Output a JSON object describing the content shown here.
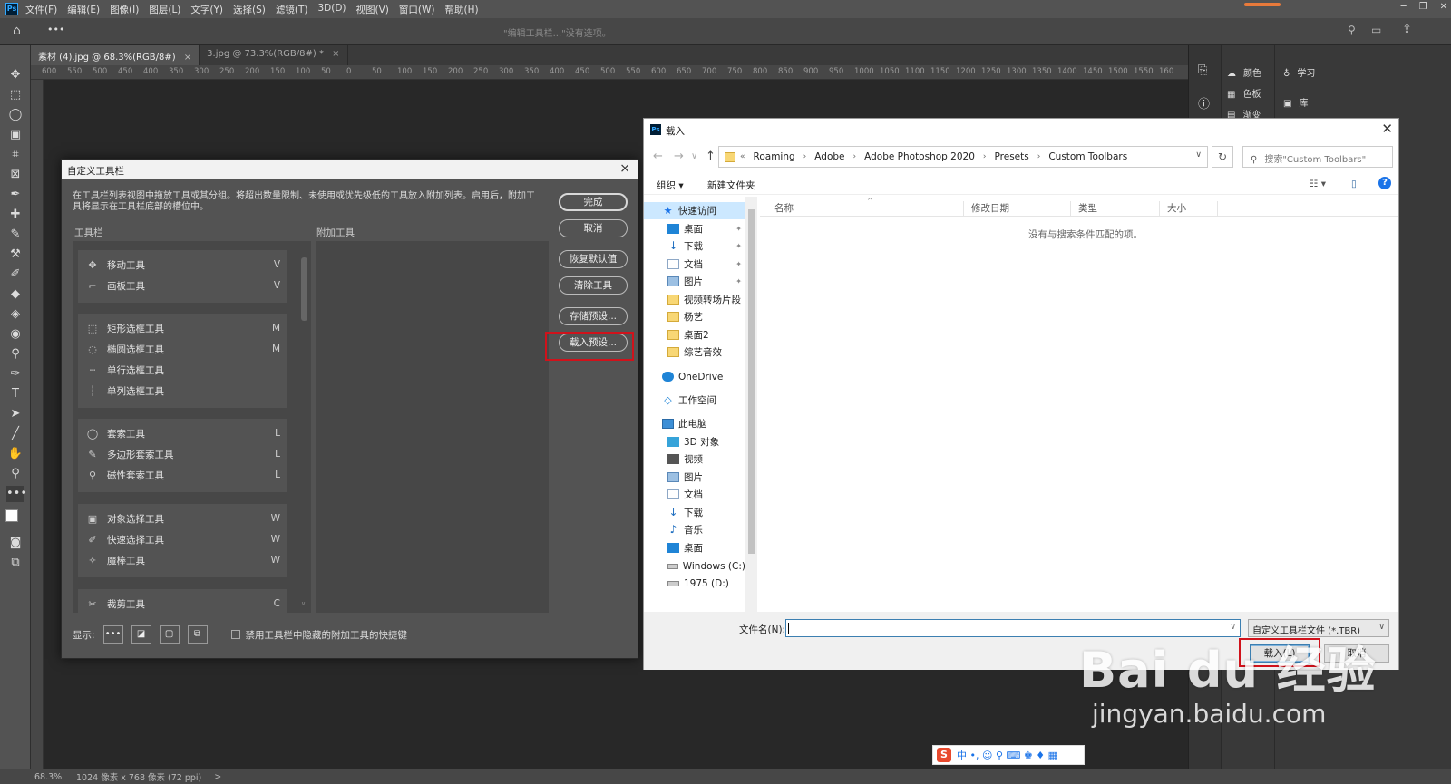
{
  "menubar": {
    "logo": "Ps",
    "items": [
      "文件(F)",
      "编辑(E)",
      "图像(I)",
      "图层(L)",
      "文字(Y)",
      "选择(S)",
      "滤镜(T)",
      "3D(D)",
      "视图(V)",
      "窗口(W)",
      "帮助(H)"
    ]
  },
  "optbar": {
    "hint": "\"编辑工具栏...\"没有选项。",
    "more": "•••"
  },
  "tabs": [
    {
      "label": "素材 (4).jpg @ 68.3%(RGB/8#)",
      "close": "×"
    },
    {
      "label": "3.jpg @ 73.3%(RGB/8#) *",
      "close": "×"
    }
  ],
  "ruler": [
    "600",
    "550",
    "500",
    "450",
    "400",
    "350",
    "300",
    "250",
    "200",
    "150",
    "100",
    "50",
    "0",
    "50",
    "100",
    "150",
    "200",
    "250",
    "300",
    "350",
    "400",
    "450",
    "500",
    "550",
    "600",
    "650",
    "700",
    "750",
    "800",
    "850",
    "900",
    "950",
    "1000",
    "1050",
    "1100",
    "1150",
    "1200",
    "1250",
    "1300",
    "1350",
    "1400",
    "1450",
    "1500",
    "1550",
    "160"
  ],
  "panels": {
    "color": "颜色",
    "swatches": "色板",
    "gradient": "渐变",
    "learn": "学习",
    "library": "库"
  },
  "status": {
    "zoom": "68.3%",
    "info": "1024 像素 x 768 像素 (72 ppi)",
    "arrow": ">"
  },
  "customize": {
    "title": "自定义工具栏",
    "description": "在工具栏列表视图中拖放工具或其分组。将超出数量限制、未使用或优先级低的工具放入附加列表。启用后，附加工具将显示在工具栏底部的槽位中。",
    "toolbar_label": "工具栏",
    "extra_label": "附加工具",
    "groups": [
      [
        {
          "icon": "✥",
          "label": "移动工具",
          "key": "V"
        },
        {
          "icon": "⌐",
          "label": "画板工具",
          "key": "V"
        }
      ],
      [
        {
          "icon": "⬚",
          "label": "矩形选框工具",
          "key": "M"
        },
        {
          "icon": "◌",
          "label": "椭圆选框工具",
          "key": "M"
        },
        {
          "icon": "┄",
          "label": "单行选框工具",
          "key": ""
        },
        {
          "icon": "┆",
          "label": "单列选框工具",
          "key": ""
        }
      ],
      [
        {
          "icon": "◯",
          "label": "套索工具",
          "key": "L"
        },
        {
          "icon": "✎",
          "label": "多边形套索工具",
          "key": "L"
        },
        {
          "icon": "⚲",
          "label": "磁性套索工具",
          "key": "L"
        }
      ],
      [
        {
          "icon": "▣",
          "label": "对象选择工具",
          "key": "W"
        },
        {
          "icon": "✐",
          "label": "快速选择工具",
          "key": "W"
        },
        {
          "icon": "✧",
          "label": "魔棒工具",
          "key": "W"
        }
      ],
      [
        {
          "icon": "✂",
          "label": "裁剪工具",
          "key": "C"
        }
      ]
    ],
    "buttons": {
      "done": "完成",
      "cancel": "取消",
      "restore": "恢复默认值",
      "clear": "清除工具",
      "save": "存储预设...",
      "load": "载入预设..."
    },
    "show_label": "显示:",
    "show_icons": [
      "•••",
      "◪",
      "▢",
      "⧉"
    ],
    "checkbox_label": "禁用工具栏中隐藏的附加工具的快捷键"
  },
  "load_dialog": {
    "title": "载入",
    "logo": "Ps",
    "path": [
      "Roaming",
      "Adobe",
      "Adobe Photoshop 2020",
      "Presets",
      "Custom Toolbars"
    ],
    "path_prefix": "«",
    "search_placeholder": "搜索\"Custom Toolbars\"",
    "organize": "组织 ▾",
    "new_folder": "新建文件夹",
    "nav": [
      {
        "label": "快速访问",
        "type": "star",
        "sel": true
      },
      {
        "label": "桌面",
        "type": "blue",
        "pin": true
      },
      {
        "label": "下载",
        "type": "down",
        "pin": true
      },
      {
        "label": "文档",
        "type": "doc",
        "pin": true
      },
      {
        "label": "图片",
        "type": "pic",
        "pin": true
      },
      {
        "label": "视频转场片段",
        "type": "folder"
      },
      {
        "label": "杨艺",
        "type": "folder"
      },
      {
        "label": "桌面2",
        "type": "folder"
      },
      {
        "label": "综艺音效",
        "type": "folder"
      },
      {
        "label": "OneDrive",
        "type": "cloud"
      },
      {
        "label": "工作空间",
        "type": "ws"
      },
      {
        "label": "此电脑",
        "type": "pc"
      },
      {
        "label": "3D 对象",
        "type": "3d"
      },
      {
        "label": "视频",
        "type": "vid"
      },
      {
        "label": "图片",
        "type": "pic"
      },
      {
        "label": "文档",
        "type": "doc"
      },
      {
        "label": "下载",
        "type": "down"
      },
      {
        "label": "音乐",
        "type": "music"
      },
      {
        "label": "桌面",
        "type": "blue"
      },
      {
        "label": "Windows (C:)",
        "type": "drive"
      },
      {
        "label": "1975 (D:)",
        "type": "drive"
      }
    ],
    "columns": [
      "名称",
      "修改日期",
      "类型",
      "大小"
    ],
    "empty_message": "没有与搜索条件匹配的项。",
    "filename_label": "文件名(N):",
    "filename_value": "",
    "filter": "自定义工具栏文件 (*.TBR)",
    "open": "载入(L)",
    "cancel": "取消"
  },
  "watermark": {
    "main": "Bai du 经验",
    "sub": "jingyan.baidu.com"
  },
  "ime": {
    "logo": "S",
    "text": "中 •, ☺ ⚲ ⌨ ♚ ♦ ▦"
  },
  "colors": {
    "highlight": "#d0121b",
    "ps_blue": "#31a8ff",
    "link_blue": "#1a73e8"
  }
}
